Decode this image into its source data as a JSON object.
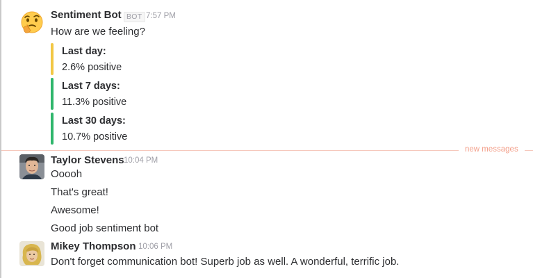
{
  "messages": [
    {
      "author": "Sentiment Bot",
      "badge": "BOT",
      "time": "7:57 PM",
      "avatar_icon": "thinking-face-emoji",
      "lines": [
        "How are we feeling?"
      ],
      "attachments": [
        {
          "title": "Last day:",
          "value": "2.6% positive",
          "color": "#f2c744"
        },
        {
          "title": "Last 7 days:",
          "value": "11.3% positive",
          "color": "#2fb66c"
        },
        {
          "title": "Last 30 days:",
          "value": "10.7% positive",
          "color": "#2fb66c"
        }
      ]
    },
    {
      "author": "Taylor Stevens",
      "time": "10:04 PM",
      "avatar_icon": "user-photo",
      "lines": [
        "Ooooh",
        "That's great!",
        "Awesome!",
        "Good job sentiment bot"
      ]
    },
    {
      "author": "Mikey Thompson",
      "time": "10:06 PM",
      "avatar_icon": "user-photo",
      "lines": [
        "Don't forget communication bot! Superb job as well. A wonderful, terrific job."
      ]
    }
  ],
  "divider": {
    "label": "new messages",
    "color": "#f39f8a"
  }
}
